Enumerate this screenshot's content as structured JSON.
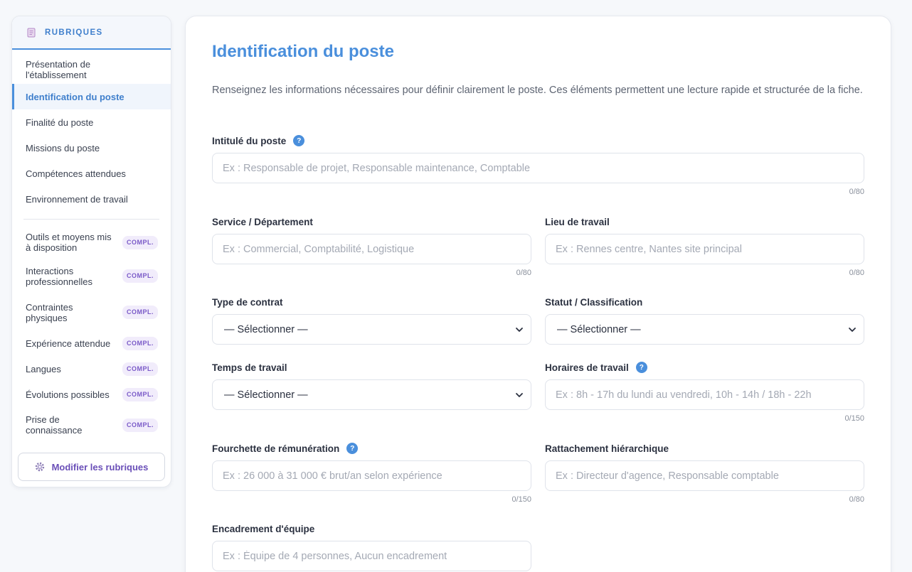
{
  "sidebar": {
    "title": "RUBRIQUES",
    "items": [
      {
        "label": "Présentation de l'établissement",
        "active": false
      },
      {
        "label": "Identification du poste",
        "active": true
      },
      {
        "label": "Finalité du poste",
        "active": false
      },
      {
        "label": "Missions du poste",
        "active": false
      },
      {
        "label": "Compétences attendues",
        "active": false
      },
      {
        "label": "Environnement de travail",
        "active": false
      }
    ],
    "optional_items": [
      {
        "label": "Outils et moyens mis à disposition",
        "badge": "COMPL."
      },
      {
        "label": "Interactions professionnelles",
        "badge": "COMPL."
      },
      {
        "label": "Contraintes physiques",
        "badge": "COMPL."
      },
      {
        "label": "Expérience attendue",
        "badge": "COMPL."
      },
      {
        "label": "Langues",
        "badge": "COMPL."
      },
      {
        "label": "Évolutions possibles",
        "badge": "COMPL."
      },
      {
        "label": "Prise de connaissance",
        "badge": "COMPL."
      }
    ],
    "edit_button": "Modifier les rubriques"
  },
  "main": {
    "title": "Identification du poste",
    "intro": "Renseignez les informations nécessaires pour définir clairement le poste. Ces éléments permettent une lecture rapide et structurée de la fiche.",
    "fields": {
      "intitule": {
        "label": "Intitulé du poste",
        "placeholder": "Ex : Responsable de projet, Responsable maintenance, Comptable",
        "counter": "0/80",
        "help": "?"
      },
      "service": {
        "label": "Service / Département",
        "placeholder": "Ex : Commercial, Comptabilité, Logistique",
        "counter": "0/80"
      },
      "lieu": {
        "label": "Lieu de travail",
        "placeholder": "Ex : Rennes centre, Nantes site principal",
        "counter": "0/80"
      },
      "contrat": {
        "label": "Type de contrat",
        "value": "— Sélectionner —"
      },
      "statut": {
        "label": "Statut / Classification",
        "value": "— Sélectionner —"
      },
      "temps": {
        "label": "Temps de travail",
        "value": "— Sélectionner —"
      },
      "horaires": {
        "label": "Horaires de travail",
        "placeholder": "Ex : 8h - 17h du lundi au vendredi, 10h - 14h / 18h - 22h",
        "counter": "0/150",
        "help": "?"
      },
      "remuneration": {
        "label": "Fourchette de rémunération",
        "placeholder": "Ex : 26 000 à 31 000 € brut/an selon expérience",
        "counter": "0/150",
        "help": "?"
      },
      "rattachement": {
        "label": "Rattachement hiérarchique",
        "placeholder": "Ex : Directeur d'agence, Responsable comptable",
        "counter": "0/80"
      },
      "encadrement": {
        "label": "Encadrement d'équipe",
        "placeholder": "Ex : Équipe de 4 personnes, Aucun encadrement"
      }
    }
  },
  "colors": {
    "accent": "#4a8fdc",
    "badge": "#7a5ac8"
  }
}
